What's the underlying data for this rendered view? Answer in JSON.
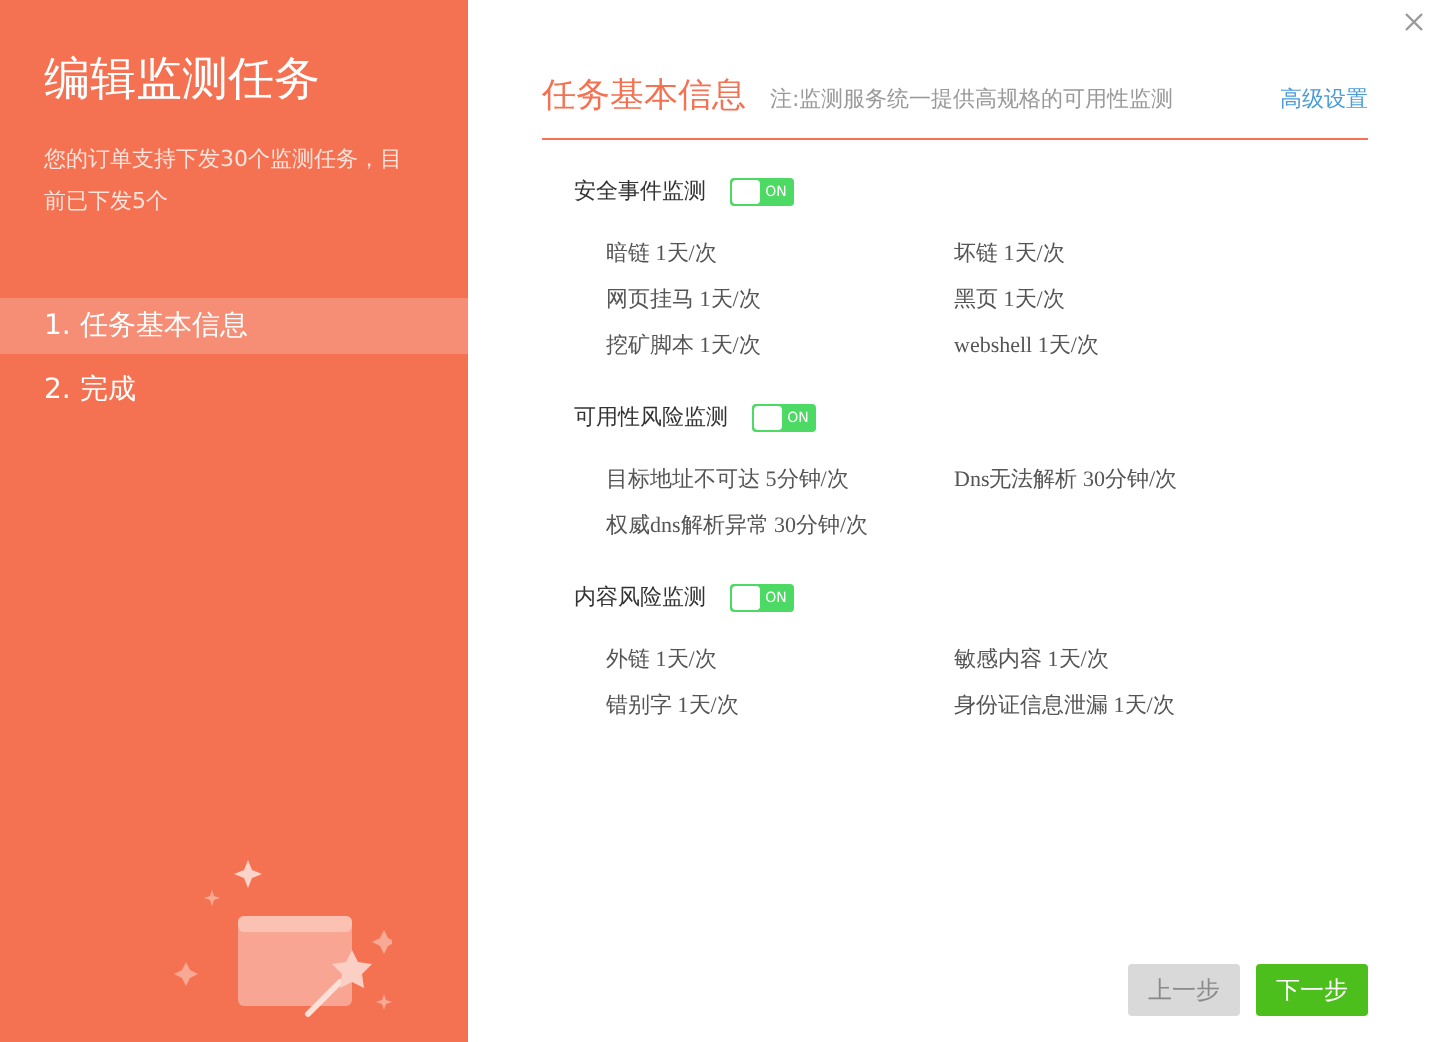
{
  "sidebar": {
    "title": "编辑监测任务",
    "description": "您的订单支持下发30个监测任务，目前已下发5个",
    "steps": [
      {
        "label": "1. 任务基本信息",
        "selected": true
      },
      {
        "label": "2. 完成",
        "selected": false
      }
    ]
  },
  "header": {
    "title": "任务基本信息",
    "note": "注:监测服务统一提供高规格的可用性监测",
    "link": "高级设置"
  },
  "sections": [
    {
      "label": "安全事件监测",
      "on": true,
      "toggle_text": "ON",
      "items": [
        "暗链 1天/次",
        "坏链 1天/次",
        "网页挂马 1天/次",
        "黑页 1天/次",
        "挖矿脚本 1天/次",
        "webshell 1天/次"
      ]
    },
    {
      "label": "可用性风险监测",
      "on": true,
      "toggle_text": "ON",
      "items": [
        "目标地址不可达 5分钟/次",
        "Dns无法解析 30分钟/次",
        "权威dns解析异常 30分钟/次"
      ]
    },
    {
      "label": "内容风险监测",
      "on": true,
      "toggle_text": "ON",
      "items": [
        "外链 1天/次",
        "敏感内容 1天/次",
        "错别字 1天/次",
        "身份证信息泄漏 1天/次"
      ]
    }
  ],
  "buttons": [
    {
      "label": "上一步",
      "disabled": true
    },
    {
      "label": "下一步",
      "disabled": false
    }
  ]
}
